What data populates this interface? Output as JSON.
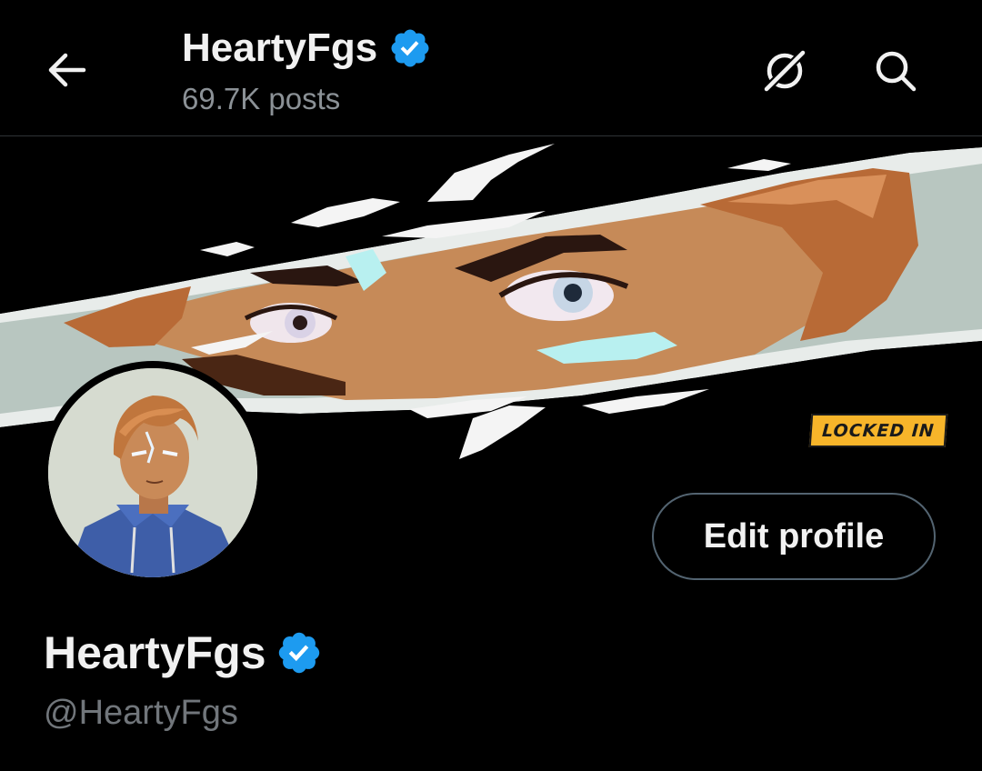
{
  "header": {
    "title": "HeartyFgs",
    "post_count": "69.7K posts",
    "back_icon": "arrow-left-icon",
    "grok_icon": "grok-icon",
    "search_icon": "search-icon"
  },
  "banner": {
    "badge_text": "LOCKED IN"
  },
  "profile": {
    "display_name": "HeartyFgs",
    "handle": "@HeartyFgs",
    "edit_button_label": "Edit profile",
    "verified_icon": "verified-badge-icon"
  },
  "colors": {
    "background": "#000000",
    "verified_blue": "#1d9bf0",
    "text_primary": "#f1f1f1",
    "text_secondary": "#71767b",
    "button_border": "#536471",
    "badge_yellow": "#f7b52a"
  }
}
